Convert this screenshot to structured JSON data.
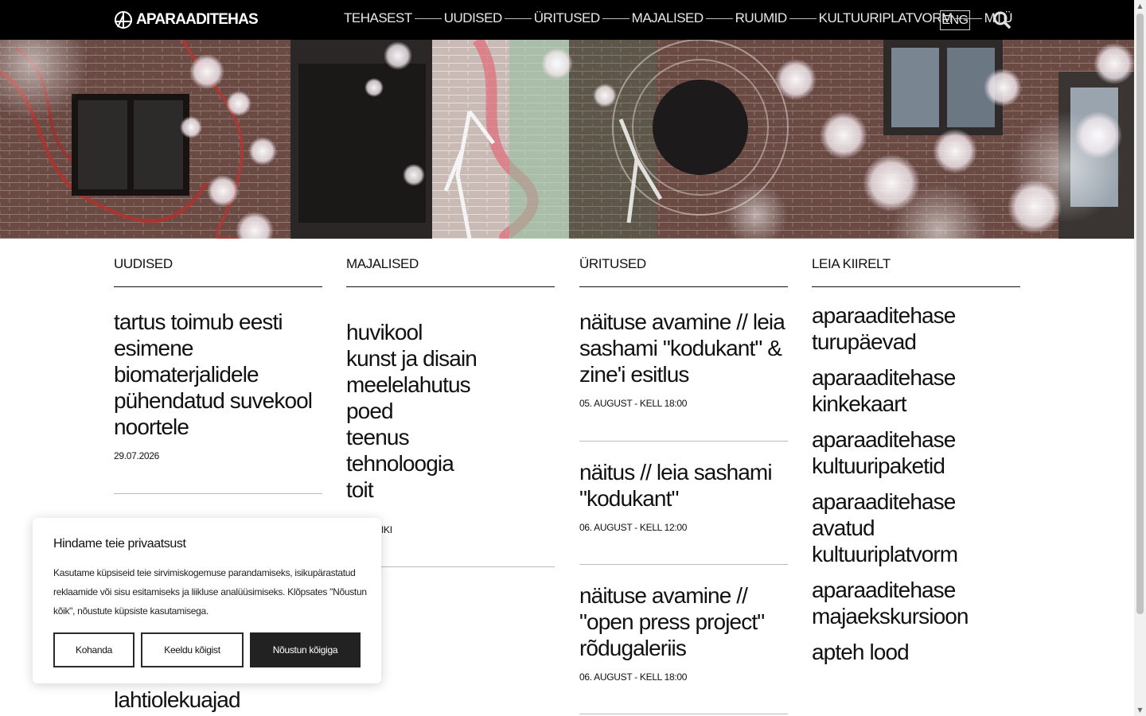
{
  "header": {
    "logo_text": "APARAADITEHAS",
    "nav": [
      "TEHASEST",
      "UUDISED",
      "ÜRITUSED",
      "MAJALISED",
      "RUUMID",
      "KULTUURIPLATVORM",
      "MTÜ"
    ],
    "lang_label": "ENG"
  },
  "columns": {
    "news": {
      "heading": "UUDISED",
      "item1_title": "tartus toimub eesti esimene biomaterjalidele pühendatud suvekool noortele",
      "item1_date": "29.07.2026",
      "partial_text": "lahtiolekuajad"
    },
    "tenants": {
      "heading": "MAJALISED",
      "categories": [
        "huvikool",
        "kunst ja disain",
        "meelelahutus",
        "poed",
        "teenus",
        "tehnoloogia",
        "toit"
      ],
      "more_text": "IKI"
    },
    "events": {
      "heading": "ÜRITUSED",
      "items": [
        {
          "title": "näituse avamine // leia sashami \"kodukant\" & zine'i esitlus",
          "date": "05. AUGUST - KELL 18:00"
        },
        {
          "title": "näitus // leia sashami \"kodukant\"",
          "date": "06. AUGUST - KELL 12:00"
        },
        {
          "title": "näituse avamine // \"open press project\" rõdugaleriis",
          "date": "06. AUGUST - KELL 18:00"
        }
      ]
    },
    "quick": {
      "heading": "LEIA KIIRELT",
      "links": [
        "aparaaditehase turupäevad",
        "aparaaditehase kinkekaart",
        "aparaaditehase kultuuripaketid",
        "aparaaditehase avatud kultuuriplatvorm",
        "aparaaditehase majaekskursioon",
        "apteh lood"
      ]
    }
  },
  "cookie": {
    "title": "Hindame teie privaatsust",
    "text": "Kasutame küpsiseid teie sirvimiskogemuse parandamiseks, isikupärastatud reklaamide või sisu esitamiseks ja liikluse analüüsimiseks. Klõpsates \"Nõustun kõik\", nõustute küpsiste kasutamisega.",
    "customize": "Kohanda",
    "reject": "Keeldu kõigist",
    "accept": "Nõustun kõigiga"
  },
  "colors": {
    "header_bg": "#000000",
    "text": "#111111",
    "accept_bg": "#222222"
  }
}
